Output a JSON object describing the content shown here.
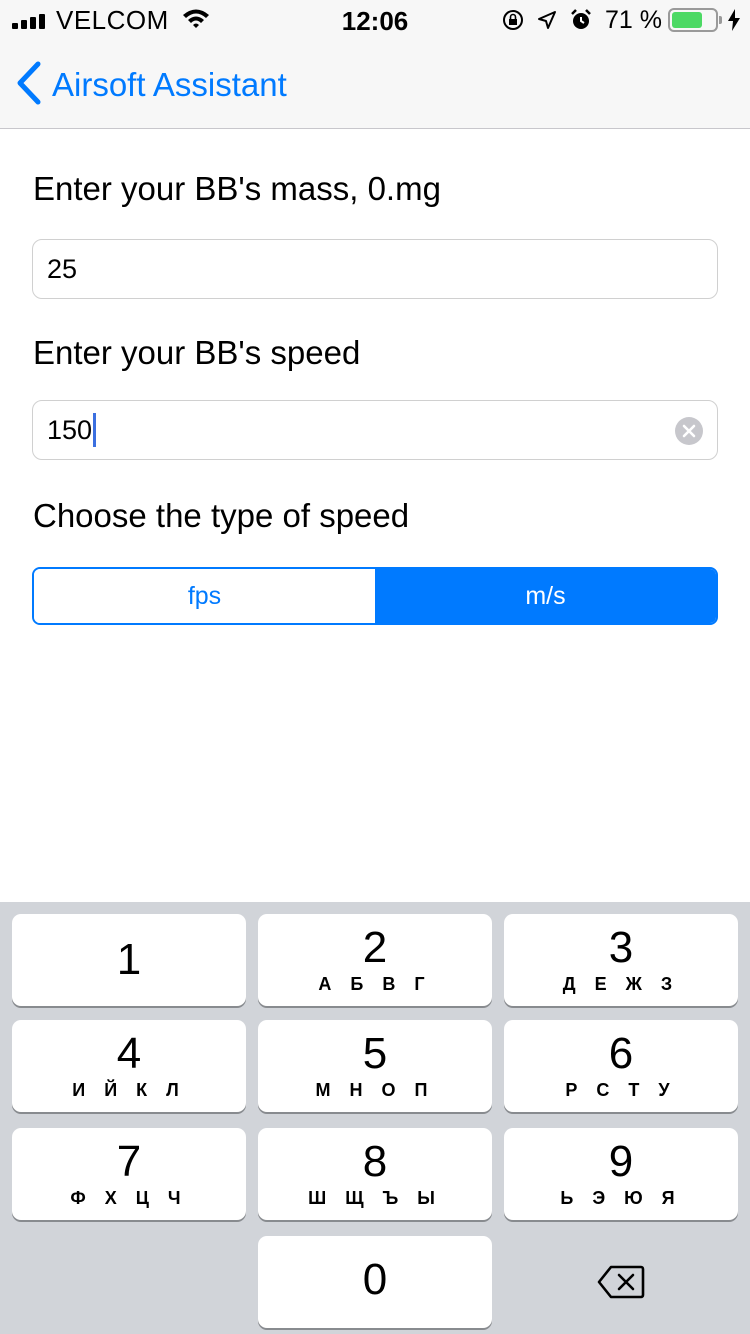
{
  "status_bar": {
    "carrier": "VELCOM",
    "time": "12:06",
    "battery_percent": "71 %",
    "battery_level": 0.71,
    "icons": [
      "signal-icon",
      "wifi-icon",
      "orientation-lock-icon",
      "location-icon",
      "alarm-icon",
      "battery-icon",
      "charging-icon"
    ]
  },
  "nav": {
    "back_label": "Airsoft Assistant"
  },
  "form": {
    "mass_label": "Enter your BB's mass, 0.mg",
    "mass_value": "25",
    "speed_label": "Enter your BB's speed",
    "speed_value": "150",
    "type_label": "Choose the type of speed",
    "segments": [
      {
        "label": "fps",
        "selected": false
      },
      {
        "label": "m/s",
        "selected": true
      }
    ]
  },
  "keypad": {
    "keys": [
      {
        "digit": "1",
        "letters": ""
      },
      {
        "digit": "2",
        "letters": "А Б В Г"
      },
      {
        "digit": "3",
        "letters": "Д Е Ж З"
      },
      {
        "digit": "4",
        "letters": "И Й К Л"
      },
      {
        "digit": "5",
        "letters": "М Н О П"
      },
      {
        "digit": "6",
        "letters": "Р С Т У"
      },
      {
        "digit": "7",
        "letters": "Ф Х Ц Ч"
      },
      {
        "digit": "8",
        "letters": "Ш Щ Ъ Ы"
      },
      {
        "digit": "9",
        "letters": "Ь Э Ю Я"
      },
      {
        "digit": "0",
        "letters": ""
      }
    ]
  },
  "colors": {
    "accent": "#007aff",
    "keypad_bg": "#d1d4d9",
    "battery_green": "#4cd964"
  }
}
